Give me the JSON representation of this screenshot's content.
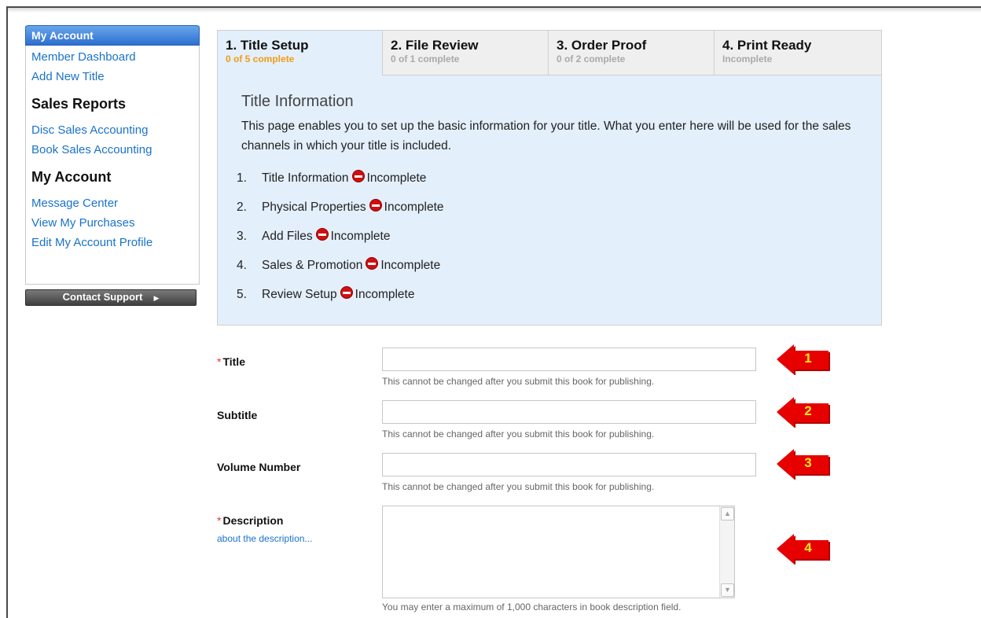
{
  "sidebar": {
    "header": "My Account",
    "links_top": [
      "Member Dashboard",
      "Add New Title"
    ],
    "section_sales": "Sales Reports",
    "links_sales": [
      "Disc Sales Accounting",
      "Book Sales Accounting"
    ],
    "section_account": "My Account",
    "links_account": [
      "Message Center",
      "View My Purchases",
      "Edit My Account Profile"
    ],
    "contact_button": "Contact Support"
  },
  "tabs": [
    {
      "title": "1. Title Setup",
      "sub": "0 of 5 complete"
    },
    {
      "title": "2. File Review",
      "sub": "0 of 1 complete"
    },
    {
      "title": "3. Order Proof",
      "sub": "0 of 2 complete"
    },
    {
      "title": "4. Print Ready",
      "sub": "Incomplete"
    }
  ],
  "panel": {
    "title": "Title Information",
    "description": "This page enables you to set up the basic information for your title. What you enter here will be used for the sales channels in which your title is included.",
    "steps": [
      {
        "num": "1.",
        "label": "Title Information",
        "status": "Incomplete"
      },
      {
        "num": "2.",
        "label": "Physical Properties",
        "status": "Incomplete"
      },
      {
        "num": "3.",
        "label": "Add Files",
        "status": "Incomplete"
      },
      {
        "num": "4.",
        "label": "Sales & Promotion",
        "status": "Incomplete"
      },
      {
        "num": "5.",
        "label": "Review Setup",
        "status": "Incomplete"
      }
    ]
  },
  "form": {
    "required_mark": "*",
    "title_label": "Title",
    "title_hint": "This cannot be changed after you submit this book for publishing.",
    "subtitle_label": "Subtitle",
    "subtitle_hint": "This cannot be changed after you submit this book for publishing.",
    "volume_label": "Volume Number",
    "volume_hint": "This cannot be changed after you submit this book for publishing.",
    "description_label": "Description",
    "description_link": "about the description...",
    "description_hint": "You may enter a maximum of 1,000 characters in book description field."
  },
  "callouts": [
    "1",
    "2",
    "3",
    "4"
  ],
  "colors": {
    "accent_blue": "#2c6fd0",
    "link": "#1a73c8",
    "active_tab_progress": "#f39c12",
    "panel_bg": "#e3effb",
    "callout_red": "#e60000",
    "callout_number": "#ffe81a"
  }
}
